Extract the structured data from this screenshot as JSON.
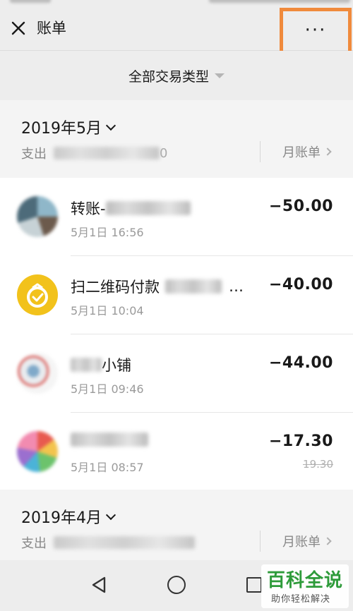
{
  "header": {
    "title": "账单",
    "more_label": "···"
  },
  "filter": {
    "label": "全部交易类型"
  },
  "months": [
    {
      "title": "2019年5月",
      "expense_label": "支出",
      "expense_suffix": "0",
      "bill_link": "月账单"
    },
    {
      "title": "2019年4月",
      "expense_label": "支出",
      "bill_link": "月账单"
    }
  ],
  "transactions": [
    {
      "name": "转账-",
      "time": "5月1日 16:56",
      "amount": "−50.00"
    },
    {
      "name": "扫二维码付款",
      "time": "5月1日 10:04",
      "amount": "−40.00"
    },
    {
      "name": "小铺",
      "time": "5月1日 09:46",
      "amount": "−44.00"
    },
    {
      "name": "",
      "time": "5月1日 08:57",
      "amount": "−17.30",
      "original": "19.30"
    }
  ],
  "watermark": {
    "main": "百科全说",
    "sub": "助你轻松解决"
  },
  "colors": {
    "highlight": "#f08a3c",
    "watermark_green": "#2e9b3a",
    "qr_icon": "#f2c21b"
  }
}
